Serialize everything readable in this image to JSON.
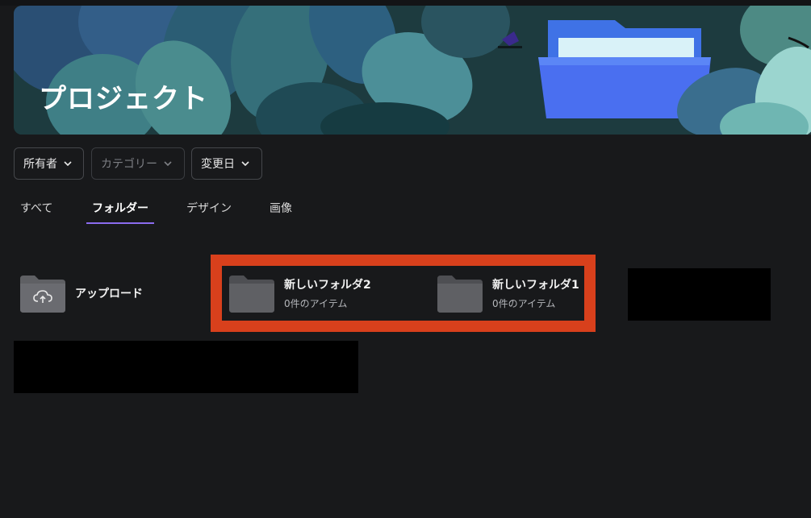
{
  "banner": {
    "title": "プロジェクト"
  },
  "filters": {
    "owner": "所有者",
    "category": "カテゴリー",
    "modified": "変更日"
  },
  "tabs": [
    {
      "label": "すべて"
    },
    {
      "label": "フォルダー"
    },
    {
      "label": "デザイン"
    },
    {
      "label": "画像"
    }
  ],
  "upload": {
    "label": "アップロード"
  },
  "folders": [
    {
      "name": "新しいフォルダ2",
      "count": "0件のアイテム"
    },
    {
      "name": "新しいフォルダ1",
      "count": "0件のアイテム"
    }
  ],
  "colors": {
    "background": "#18191b",
    "accent": "#8b6cf0",
    "highlight": "#d8401c",
    "folder": "#5f6064"
  },
  "icons": [
    "chevron-down-icon",
    "folder-icon",
    "cloud-upload-icon"
  ]
}
